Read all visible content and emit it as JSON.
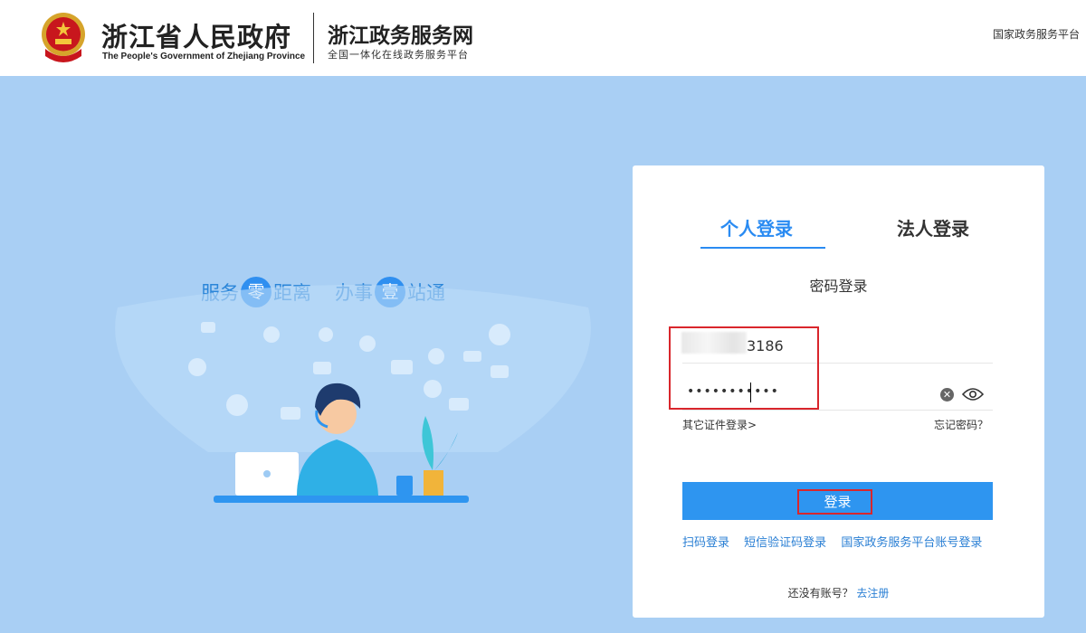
{
  "header": {
    "gov_name_cn": "浙江省人民政府",
    "gov_name_en": "The People's Government of Zhejiang Province",
    "portal_name": "浙江政务服务网",
    "portal_subtitle": "全国一体化在线政务服务平台",
    "national_link": "国家政务服务平台"
  },
  "banner": {
    "slogan_part1": "服务",
    "slogan_circle1": "零",
    "slogan_part2": "距离",
    "slogan_part3": "办事",
    "slogan_circle2": "壹",
    "slogan_part4": "站通"
  },
  "login": {
    "tabs": [
      {
        "label": "个人登录",
        "active": true
      },
      {
        "label": "法人登录",
        "active": false
      }
    ],
    "method_title": "密码登录",
    "username_visible_suffix": "3186",
    "password_mask": "•••••••••••",
    "other_cert_link": "其它证件登录>",
    "forgot_link": "忘记密码？",
    "submit_label": "登录",
    "alt_methods": [
      "扫码登录",
      "短信验证码登录",
      "国家政务服务平台账号登录"
    ],
    "register_prompt": "还没有账号？",
    "register_link": "去注册"
  },
  "colors": {
    "accent": "#2a8bf2",
    "button": "#2e95f0",
    "page_bg": "#a9cff4",
    "highlight_box": "#d9262c"
  }
}
